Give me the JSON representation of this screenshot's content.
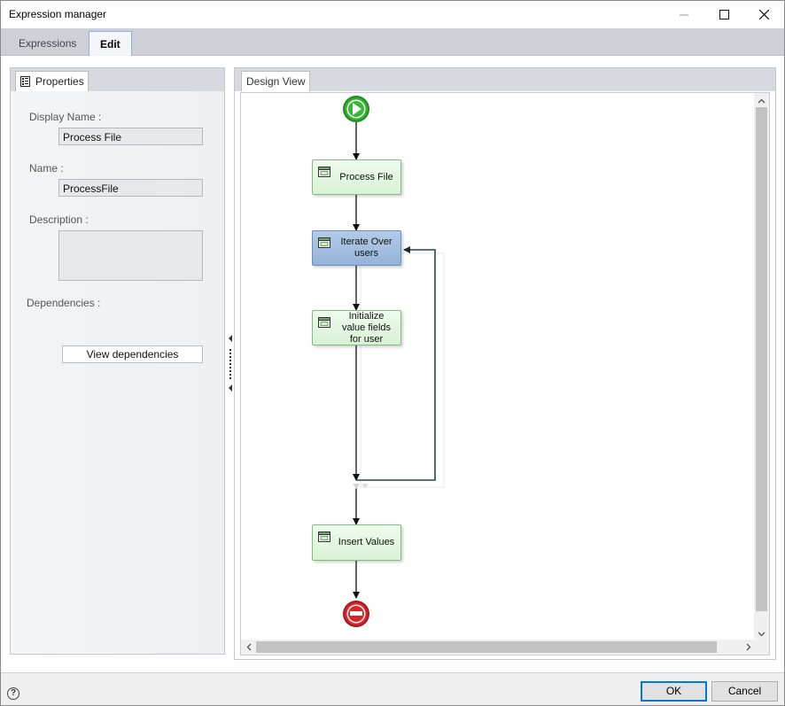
{
  "window": {
    "title": "Expression manager"
  },
  "tabs": [
    {
      "label": "Expressions",
      "active": false
    },
    {
      "label": "Edit",
      "active": true
    }
  ],
  "properties": {
    "tab_label": "Properties",
    "display_name_label": "Display Name :",
    "display_name_value": "Process File",
    "name_label": "Name :",
    "name_value": "ProcessFile",
    "description_label": "Description :",
    "description_value": "",
    "dependencies_label": "Dependencies :",
    "view_dependencies_label": "View dependencies"
  },
  "design": {
    "tab_label": "Design View",
    "nodes": [
      {
        "id": "process-file",
        "lines": [
          "Process File"
        ],
        "style": "green"
      },
      {
        "id": "iterate-over-users",
        "lines": [
          "Iterate Over",
          "users"
        ],
        "style": "blue"
      },
      {
        "id": "initialize-value-fields",
        "lines": [
          "Initialize",
          "value fields",
          "for user"
        ],
        "style": "green"
      },
      {
        "id": "insert-values",
        "lines": [
          "Insert Values"
        ],
        "style": "green"
      }
    ]
  },
  "footer": {
    "help_glyph": "?",
    "ok_label": "OK",
    "cancel_label": "Cancel"
  },
  "colors": {
    "accent": "#0078d7",
    "start_green": "#2fb12f",
    "stop_red": "#d9242a",
    "node_green": "#d9f2d6",
    "node_blue": "#94b3d8",
    "loop_line": "#1e4a4a"
  }
}
